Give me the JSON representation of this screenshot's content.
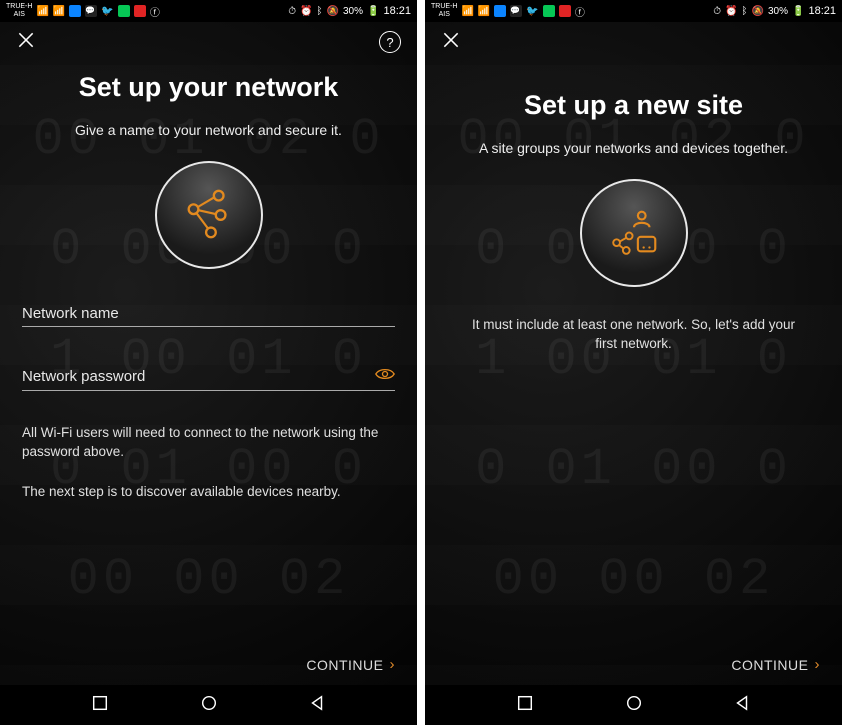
{
  "status": {
    "carrier_top": "TRUE-H",
    "carrier_bottom": "AIS",
    "battery_pct": "30%",
    "time": "18:21",
    "reception_icon": "signal-bars-icon",
    "app_icons": [
      "messenger-icon",
      "line-icon",
      "twitter-icon",
      "line2-icon",
      "garena-icon",
      "facebook-icon"
    ],
    "right_icons": [
      "alarm-icon",
      "alarm2-icon",
      "bluetooth-icon",
      "mute-icon",
      "battery-icon"
    ]
  },
  "left": {
    "title": "Set up your network",
    "subtitle": "Give a name to your network and secure it.",
    "field_name_label": "Network name",
    "field_password_label": "Network password",
    "info1": "All Wi-Fi users will need to connect to the network using the password above.",
    "info2": "The next step is to discover available devices nearby.",
    "continue": "CONTINUE",
    "hero_icon": "network-nodes-icon"
  },
  "right": {
    "title": "Set up a new site",
    "subtitle": "A site groups your networks and devices together.",
    "info": "It must include at least one network. So, let's add your first network.",
    "continue": "CONTINUE",
    "hero_icon": "site-group-icon"
  },
  "colors": {
    "accent": "#e38a1f"
  }
}
